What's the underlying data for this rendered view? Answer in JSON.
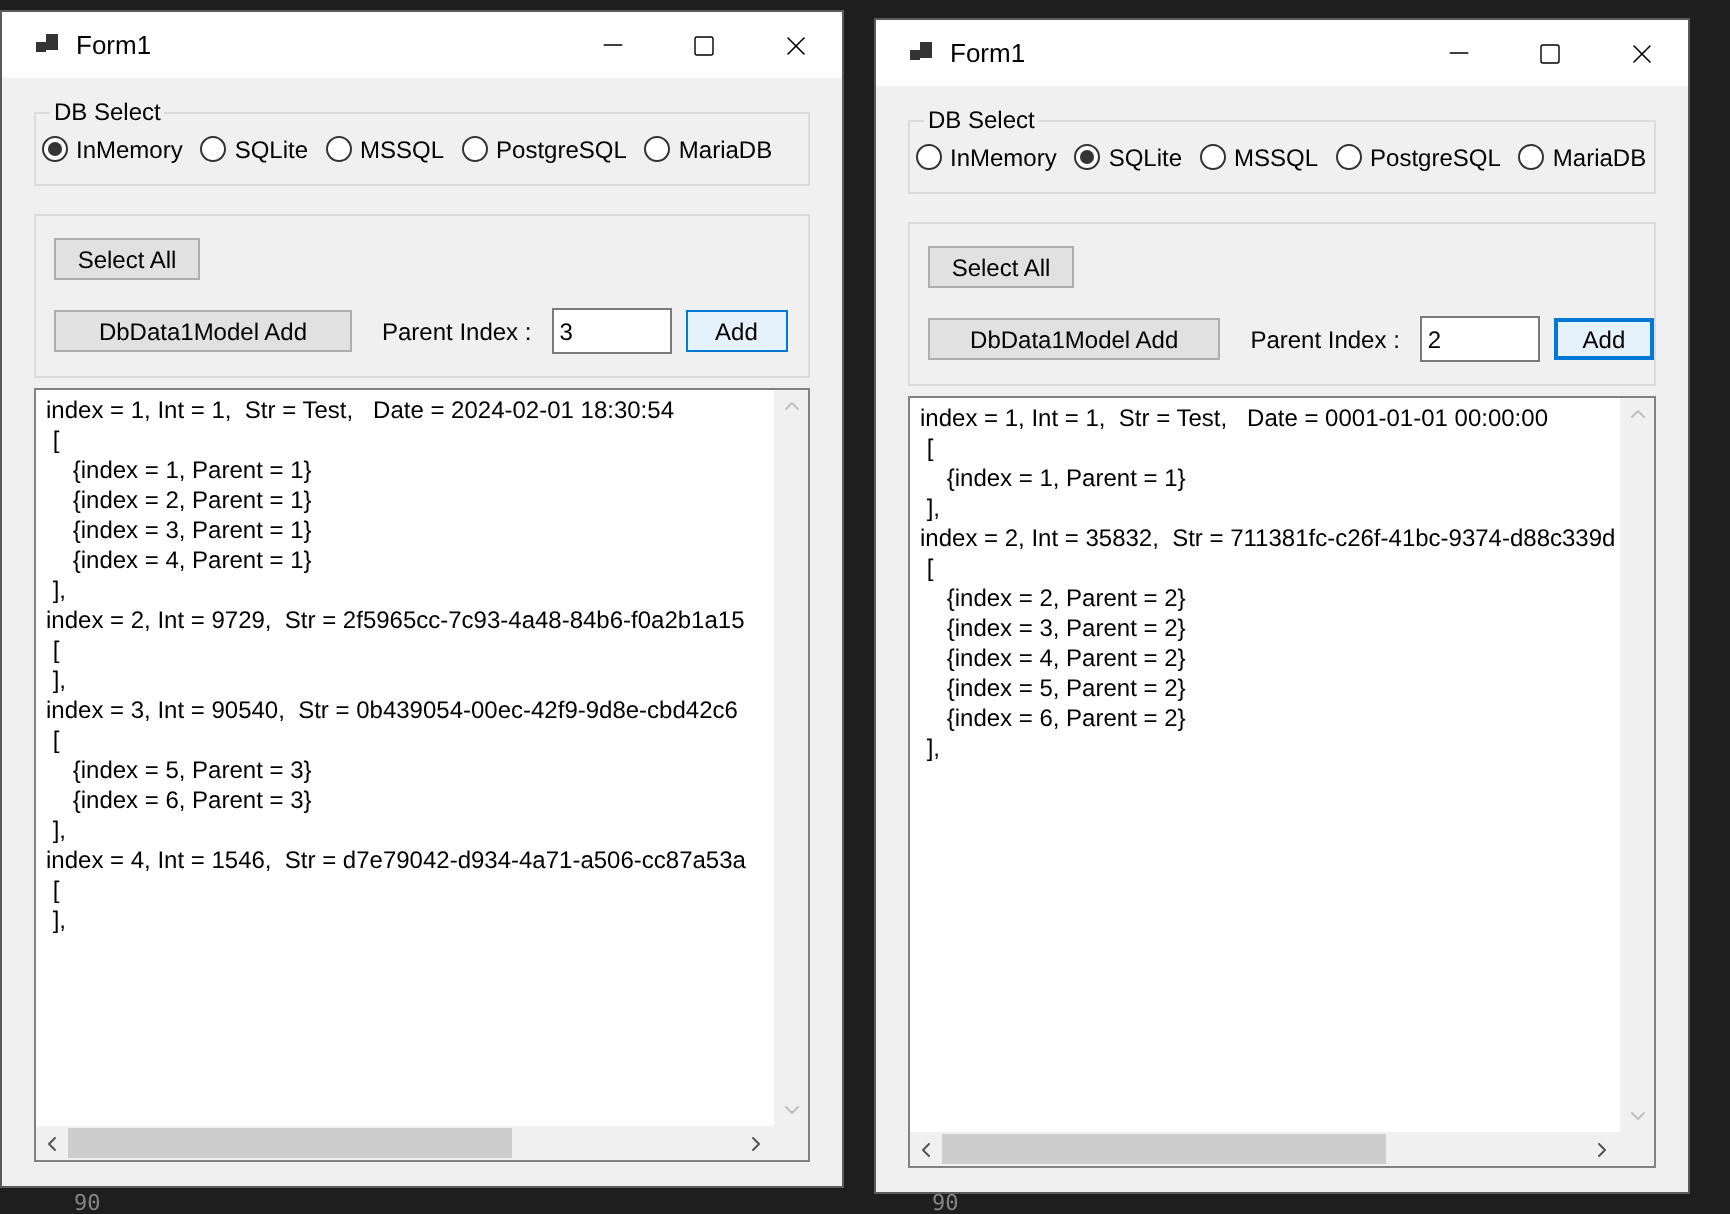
{
  "windows": [
    {
      "title": "Form1",
      "group_label": "DB Select",
      "radios": [
        {
          "label": "InMemory",
          "selected": true
        },
        {
          "label": "SQLite",
          "selected": false
        },
        {
          "label": "MSSQL",
          "selected": false
        },
        {
          "label": "PostgreSQL",
          "selected": false
        },
        {
          "label": "MariaDB",
          "selected": false
        }
      ],
      "select_all_button": "Select All",
      "model_add_button": "DbData1Model Add",
      "parent_index_label": "Parent Index :",
      "parent_index_value": "3",
      "add_button": {
        "label": "Add",
        "focused": false
      },
      "output_lines": [
        "index = 1, Int = 1,  Str = Test,   Date = 2024-02-01 18:30:54",
        " [",
        "\t{index = 1, Parent = 1}",
        "\t{index = 2, Parent = 1}",
        "\t{index = 3, Parent = 1}",
        "\t{index = 4, Parent = 1}",
        " ],",
        "index = 2, Int = 9729,  Str = 2f5965cc-7c93-4a48-84b6-f0a2b1a15",
        " [",
        " ],",
        "index = 3, Int = 90540,  Str = 0b439054-00ec-42f9-9d8e-cbd42c6",
        " [",
        "\t{index = 5, Parent = 3}",
        "\t{index = 6, Parent = 3}",
        " ],",
        "index = 4, Int = 1546,  Str = d7e79042-d934-4a71-a506-cc87a53a",
        " [",
        " ],"
      ],
      "editor_line_number": "90"
    },
    {
      "title": "Form1",
      "group_label": "DB Select",
      "radios": [
        {
          "label": "InMemory",
          "selected": false
        },
        {
          "label": "SQLite",
          "selected": true
        },
        {
          "label": "MSSQL",
          "selected": false
        },
        {
          "label": "PostgreSQL",
          "selected": false
        },
        {
          "label": "MariaDB",
          "selected": false
        }
      ],
      "select_all_button": "Select All",
      "model_add_button": "DbData1Model Add",
      "parent_index_label": "Parent Index :",
      "parent_index_value": "2",
      "add_button": {
        "label": "Add",
        "focused": true
      },
      "output_lines": [
        "index = 1, Int = 1,  Str = Test,   Date = 0001-01-01 00:00:00",
        " [",
        "\t{index = 1, Parent = 1}",
        " ],",
        "index = 2, Int = 35832,  Str = 711381fc-c26f-41bc-9374-d88c339d",
        " [",
        "\t{index = 2, Parent = 2}",
        "\t{index = 3, Parent = 2}",
        "\t{index = 4, Parent = 2}",
        "\t{index = 5, Parent = 2}",
        "\t{index = 6, Parent = 2}",
        " ],"
      ],
      "editor_line_number": "90"
    }
  ]
}
